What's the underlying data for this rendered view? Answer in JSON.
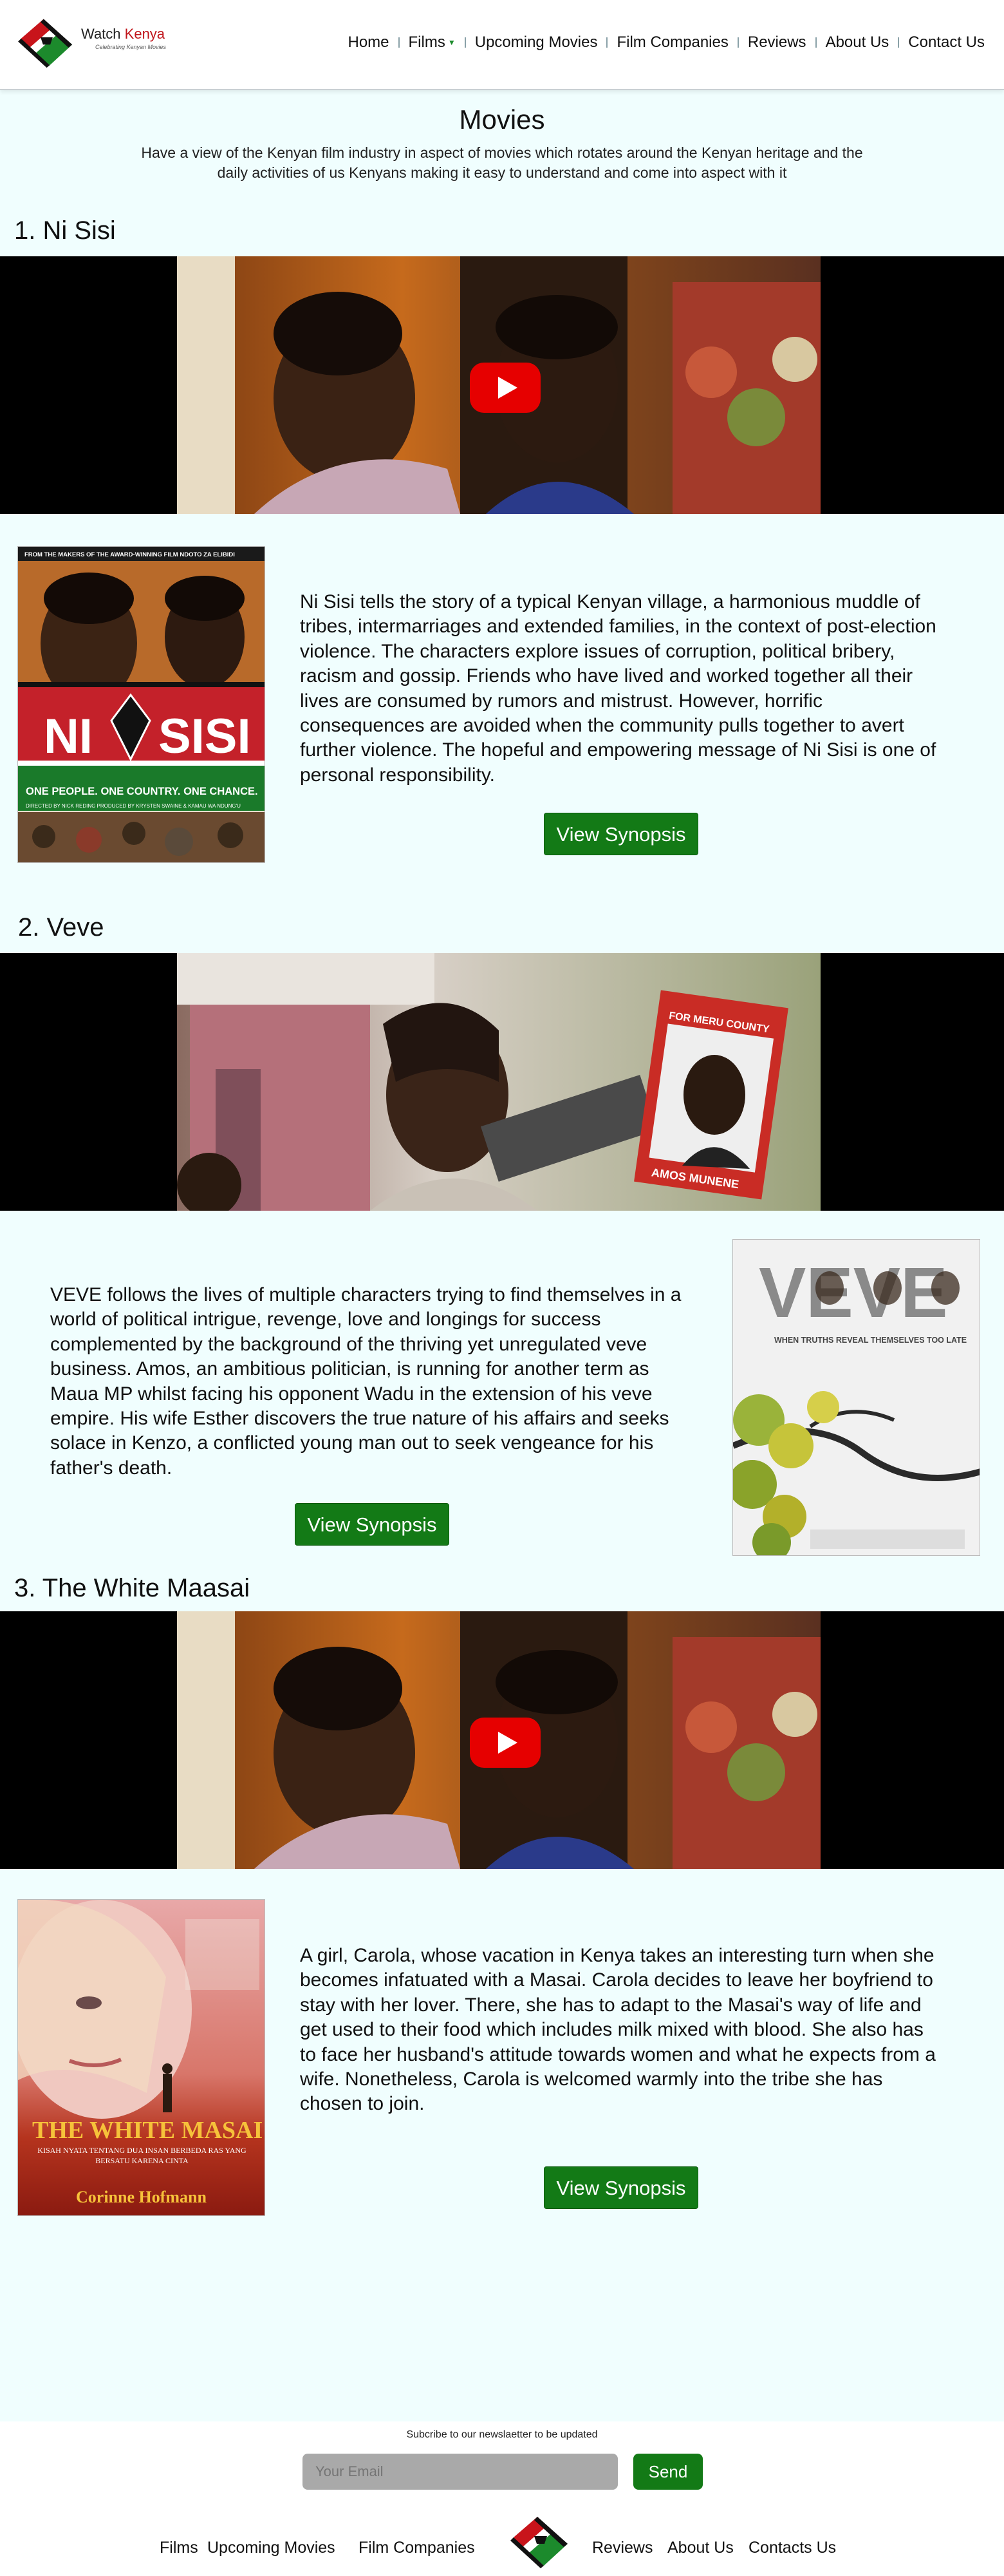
{
  "header": {
    "logo_title_a": "Watch ",
    "logo_title_b": "Kenya",
    "logo_tagline": "Celebrating Kenyan Movies",
    "nav": [
      "Home",
      "Films",
      "Upcoming Movies",
      "Film Companies",
      "Reviews",
      "About Us",
      "Contact Us"
    ]
  },
  "main": {
    "title": "Movies",
    "intro": "Have a view of the Kenyan film industry in aspect of movies which rotates around the Kenyan heritage and the daily activities of us Kenyans making it easy to understand and come into aspect with it"
  },
  "movies": [
    {
      "heading": "1. Ni Sisi",
      "description": "Ni Sisi tells the story of a typical Kenyan village, a harmonious muddle of tribes, intermarriages and extended families, in the context of post-election violence. The characters explore issues of corruption, political bribery, racism and gossip. Friends who have lived and worked together all their lives are consumed by rumors and mistrust. However, horrific consequences are avoided when the community pulls together to avert further violence. The hopeful and empowering message of Ni Sisi is one of personal responsibility.",
      "button": "View Synopsis",
      "poster_top": "FROM THE MAKERS OF THE AWARD-WINNING FILM NDOTO ZA ELIBIDI",
      "poster_title_a": "NI",
      "poster_title_b": "SISI",
      "poster_tagline": "ONE PEOPLE. ONE COUNTRY. ONE CHANCE.",
      "poster_credit": "DIRECTED BY NICK REDING    PRODUCED BY KRYSTEN SWAINE & KAMAU WA NDUNG'U"
    },
    {
      "heading": "2. Veve",
      "description": "VEVE follows the lives of multiple characters trying to find themselves in a world of political intrigue, revenge, love and longings for success complemented by the background of the thriving yet unregulated veve business. Amos, an ambitious politician, is running for another term as Maua MP whilst facing his opponent Wadu in the extension of his veve empire. His wife Esther discovers the true nature of his affairs and seeks solace in Kenzo, a conflicted young man out to seek vengeance for his father's death.",
      "button": "View Synopsis",
      "video_sign_top": "FOR MERU COUNTY",
      "video_sign_bottom": "AMOS MUNENE",
      "poster_title": "VEVE",
      "poster_tagline": "WHEN TRUTHS REVEAL THEMSELVES TOO LATE"
    },
    {
      "heading": "3. The White Maasai",
      "description": "A girl, Carola, whose vacation in Kenya takes an interesting turn when she becomes infatuated with a Masai. Carola decides to leave her boyfriend to stay with her lover. There, she has to adapt to the Masai's way of life and get used to their food which includes milk mixed with blood. She also has to face her husband's attitude towards women and what he expects from a wife. Nonetheless, Carola is welcomed warmly into the tribe she has chosen to join.",
      "button": "View Synopsis",
      "poster_title": "THE WHITE MASAI",
      "poster_sub": "KISAH NYATA TENTANG DUA INSAN BERBEDA RAS YANG BERSATU KARENA CINTA",
      "poster_author": "Corinne Hofmann"
    }
  ],
  "footer": {
    "subscribe_label": "Subcribe to our newslaetter to be updated",
    "email_placeholder": "Your Email",
    "send": "Send",
    "links": [
      "Films",
      "Upcoming Movies",
      "Film Companies",
      "Reviews",
      "About Us",
      "Contacts Us"
    ]
  },
  "colors": {
    "accent_green": "#137a16",
    "brand_red": "#c0151b",
    "page_bg": "#f0fefe"
  },
  "icons": {
    "play": "youtube-play-icon",
    "logo": "kenya-shield-logo",
    "dropdown": "caret-down-icon"
  }
}
